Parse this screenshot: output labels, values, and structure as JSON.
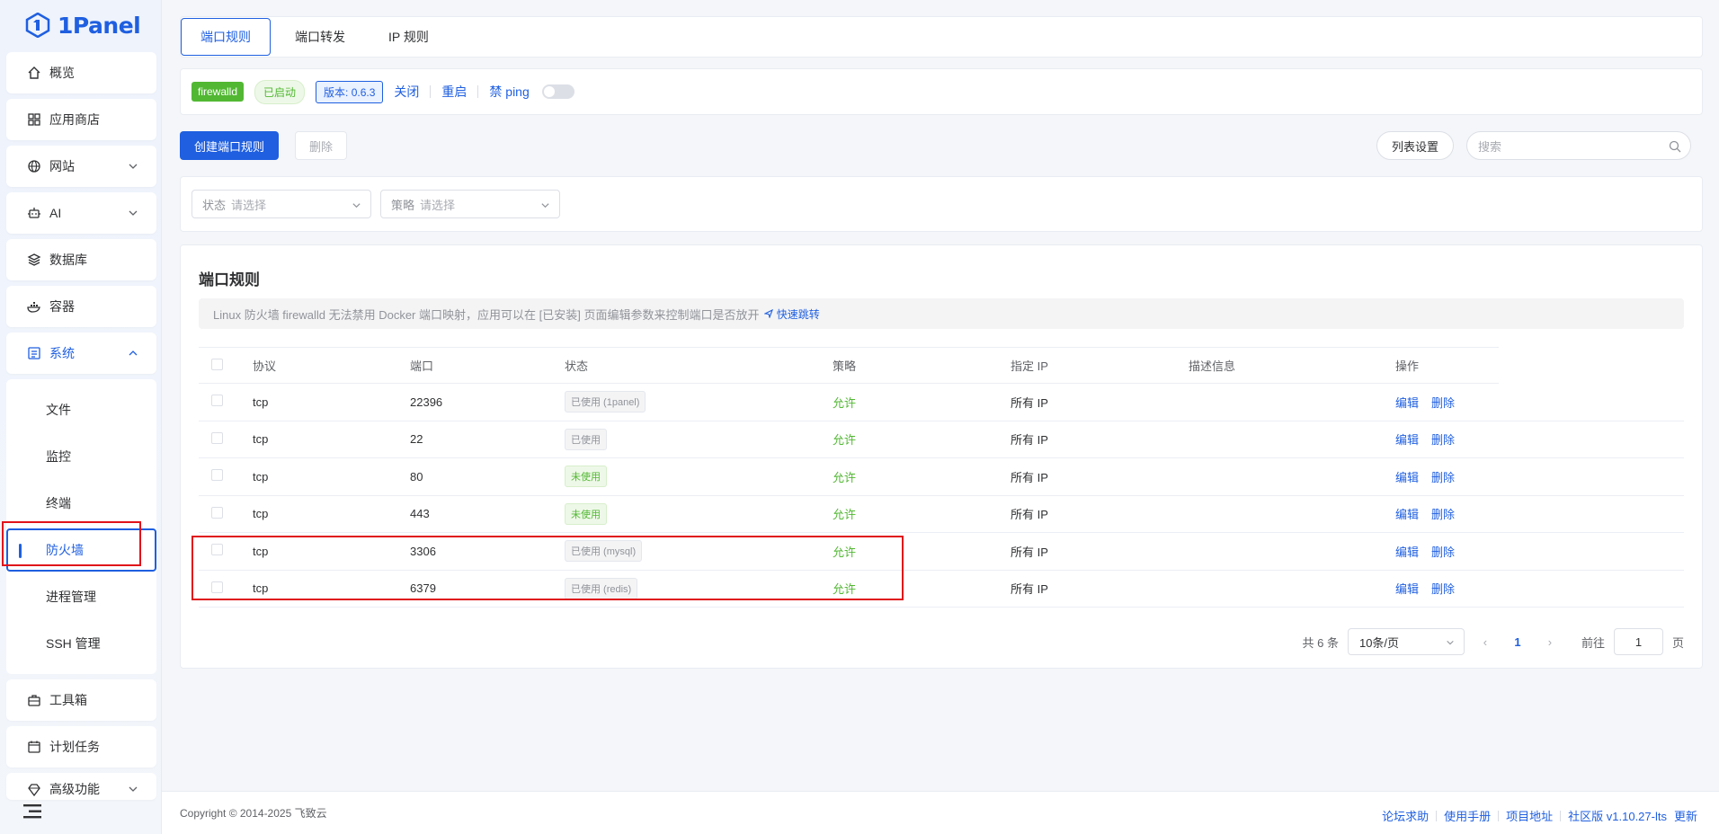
{
  "brand": {
    "name": "1Panel",
    "color": "#1f5fe0"
  },
  "sidebar": {
    "items": [
      {
        "label": "概览",
        "icon": "home-icon"
      },
      {
        "label": "应用商店",
        "icon": "grid-icon"
      },
      {
        "label": "网站",
        "icon": "globe-icon",
        "expandable": true
      },
      {
        "label": "AI",
        "icon": "robot-icon",
        "expandable": true
      },
      {
        "label": "数据库",
        "icon": "layers-icon"
      },
      {
        "label": "容器",
        "icon": "docker-icon"
      },
      {
        "label": "系统",
        "icon": "system-icon",
        "expanded": true
      }
    ],
    "system_sub": [
      "文件",
      "监控",
      "终端",
      "防火墙",
      "进程管理",
      "SSH 管理"
    ],
    "active_sub": "防火墙",
    "bottom_items": [
      {
        "label": "工具箱",
        "icon": "toolbox-icon"
      },
      {
        "label": "计划任务",
        "icon": "calendar-icon"
      },
      {
        "label": "高级功能",
        "icon": "diamond-icon",
        "expandable": true
      }
    ]
  },
  "tabs": [
    "端口规则",
    "端口转发",
    "IP 规则"
  ],
  "status": {
    "engine": "firewalld",
    "state": "已启动",
    "version": "版本: 0.6.3",
    "stop": "关闭",
    "restart": "重启",
    "ping": "禁 ping"
  },
  "toolbar": {
    "create": "创建端口规则",
    "delete": "删除",
    "columns": "列表设置",
    "search_placeholder": "搜索"
  },
  "filters": {
    "status_label": "状态",
    "status_placeholder": "请选择",
    "strategy_label": "策略",
    "strategy_placeholder": "请选择"
  },
  "section": {
    "title": "端口规则",
    "notice": "Linux 防火墙 firewalld 无法禁用 Docker 端口映射，应用可以在 [已安装] 页面编辑参数来控制端口是否放开",
    "jump": "快速跳转"
  },
  "table": {
    "headers": [
      "协议",
      "端口",
      "状态",
      "策略",
      "指定 IP",
      "描述信息",
      "操作"
    ],
    "rows": [
      {
        "protocol": "tcp",
        "port": "22396",
        "status": "已使用 (1panel)",
        "used": true,
        "strategy": "允许",
        "ip": "所有 IP",
        "desc": ""
      },
      {
        "protocol": "tcp",
        "port": "22",
        "status": "已使用",
        "used": true,
        "strategy": "允许",
        "ip": "所有 IP",
        "desc": ""
      },
      {
        "protocol": "tcp",
        "port": "80",
        "status": "未使用",
        "used": false,
        "strategy": "允许",
        "ip": "所有 IP",
        "desc": ""
      },
      {
        "protocol": "tcp",
        "port": "443",
        "status": "未使用",
        "used": false,
        "strategy": "允许",
        "ip": "所有 IP",
        "desc": ""
      },
      {
        "protocol": "tcp",
        "port": "3306",
        "status": "已使用 (mysql)",
        "used": true,
        "strategy": "允许",
        "ip": "所有 IP",
        "desc": ""
      },
      {
        "protocol": "tcp",
        "port": "6379",
        "status": "已使用 (redis)",
        "used": true,
        "strategy": "允许",
        "ip": "所有 IP",
        "desc": ""
      }
    ],
    "edit": "编辑",
    "remove": "删除"
  },
  "pager": {
    "total": "共 6 条",
    "page_size": "10条/页",
    "current": "1",
    "goto_label": "前往",
    "goto_value": "1",
    "page_unit": "页"
  },
  "footer": {
    "copyright": "Copyright © 2014-2025 飞致云",
    "links": [
      "论坛求助",
      "使用手册",
      "项目地址",
      "社区版 v1.10.27-lts",
      "更新"
    ]
  }
}
